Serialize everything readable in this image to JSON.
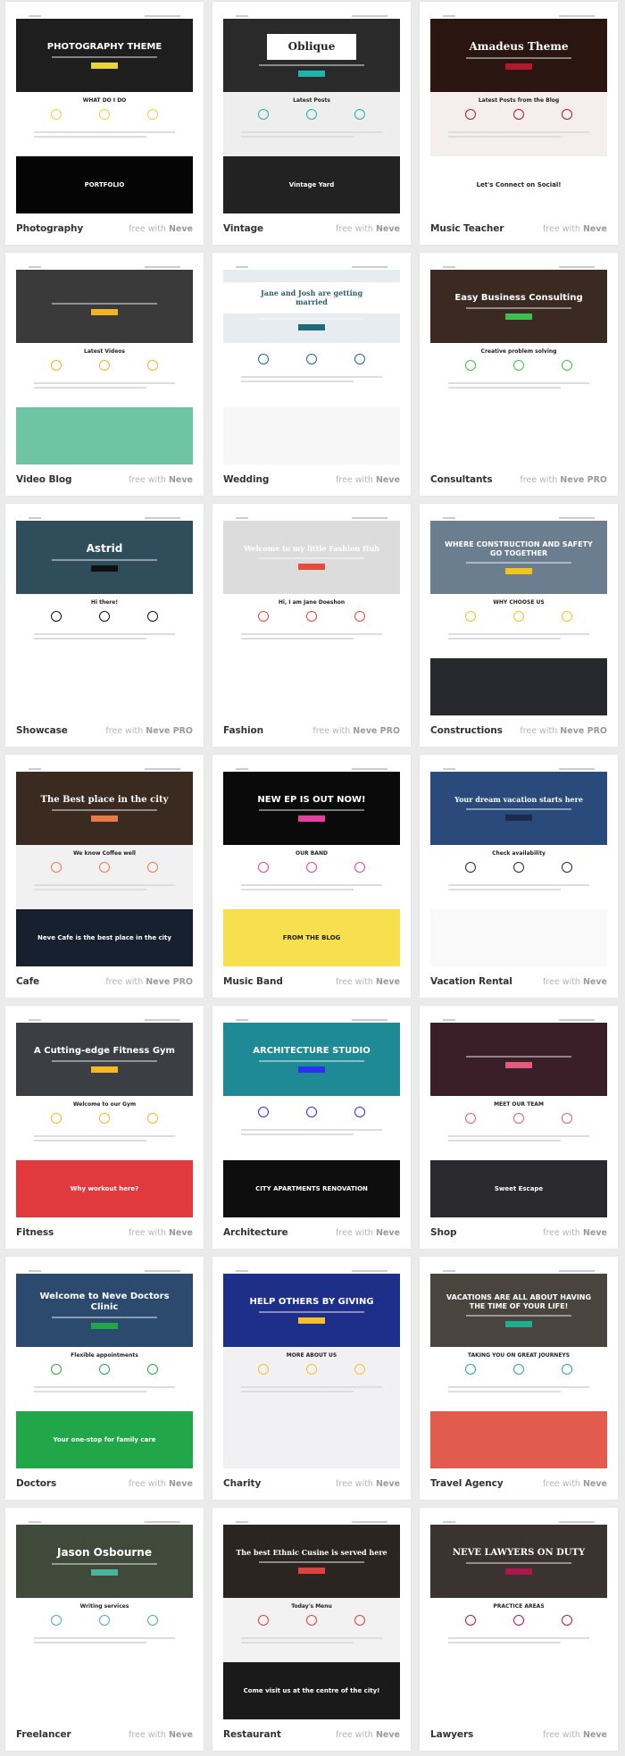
{
  "badge_prefix": "free with",
  "templates": [
    {
      "name": "Photography",
      "plan": "Neve",
      "hero_text": "PHOTOGRAPHY THEME",
      "hero_bg": "#1e1e1e",
      "hero_fg": "#ffffff",
      "hero_serif": false,
      "section_title": "WHAT DO I DO",
      "section_bg": "#ffffff",
      "band_text": "PORTFOLIO",
      "band_bg": "#050505",
      "accent": "#e8d43a"
    },
    {
      "name": "Vintage",
      "plan": "Neve",
      "hero_text": "Oblique",
      "hero_bg": "#2a2a2a",
      "hero_fg": "#222222",
      "hero_serif": true,
      "section_title": "Latest Posts",
      "section_bg": "#eeeeee",
      "band_text": "Vintage Yard",
      "band_bg": "#222222",
      "accent": "#1fb5ac"
    },
    {
      "name": "Music Teacher",
      "plan": "Neve",
      "hero_text": "Amadeus Theme",
      "hero_bg": "#2a1510",
      "hero_fg": "#ffffff",
      "hero_serif": true,
      "section_title": "Latest Posts from the Blog",
      "section_bg": "#f4efec",
      "band_text": "Let's Connect on Social!",
      "band_bg": "#ffffff",
      "accent": "#b01a2c"
    },
    {
      "name": "Video Blog",
      "plan": "Neve",
      "hero_text": "",
      "hero_bg": "#3a3a3a",
      "hero_fg": "#ffffff",
      "hero_serif": false,
      "section_title": "Latest Videos",
      "section_bg": "#ffffff",
      "band_text": "",
      "band_bg": "#6fc5a3",
      "accent": "#f0b429"
    },
    {
      "name": "Wedding",
      "plan": "Neve",
      "hero_text": "Jane and Josh are getting married",
      "hero_bg": "#e6ecef",
      "hero_fg": "#2a5d6e",
      "hero_serif": true,
      "section_title": "",
      "section_bg": "#ffffff",
      "band_text": "",
      "band_bg": "#f7f7f7",
      "accent": "#1f6a78"
    },
    {
      "name": "Consultants",
      "plan": "Neve PRO",
      "hero_text": "Easy Business Consulting",
      "hero_bg": "#3b2a22",
      "hero_fg": "#ffffff",
      "hero_serif": false,
      "section_title": "Creative problem solving",
      "section_bg": "#ffffff",
      "band_text": "",
      "band_bg": "#ffffff",
      "accent": "#3cc04b"
    },
    {
      "name": "Showcase",
      "plan": "Neve PRO",
      "hero_text": "Astrid",
      "hero_bg": "#2f4d5a",
      "hero_fg": "#ffffff",
      "hero_serif": false,
      "section_title": "Hi there!",
      "section_bg": "#ffffff",
      "band_text": "",
      "band_bg": "#ffffff",
      "accent": "#111111"
    },
    {
      "name": "Fashion",
      "plan": "Neve PRO",
      "hero_text": "Welcome to my little Fashion Hub",
      "hero_bg": "#dcdcdc",
      "hero_fg": "#ffffff",
      "hero_serif": true,
      "section_title": "Hi, I am Jane Doeshon",
      "section_bg": "#ffffff",
      "band_text": "",
      "band_bg": "#ffffff",
      "accent": "#e24c3d"
    },
    {
      "name": "Constructions",
      "plan": "Neve PRO",
      "hero_text": "WHERE CONSTRUCTION AND SAFETY GO TOGETHER",
      "hero_bg": "#6a7e90",
      "hero_fg": "#ffffff",
      "hero_serif": false,
      "section_title": "WHY CHOOSE US",
      "section_bg": "#ffffff",
      "band_text": "",
      "band_bg": "#27292e",
      "accent": "#f2c318"
    },
    {
      "name": "Cafe",
      "plan": "Neve PRO",
      "hero_text": "The Best place in the city",
      "hero_bg": "#3a2a20",
      "hero_fg": "#ffffff",
      "hero_serif": true,
      "section_title": "We know Coffee well",
      "section_bg": "#f1f1f1",
      "band_text": "Neve Cafe is the best place in the city",
      "band_bg": "#17202e",
      "accent": "#ea7a4a"
    },
    {
      "name": "Music Band",
      "plan": "Neve",
      "hero_text": "NEW EP IS OUT NOW!",
      "hero_bg": "#0a0a0a",
      "hero_fg": "#ffffff",
      "hero_serif": false,
      "section_title": "OUR BAND",
      "section_bg": "#ffffff",
      "band_text": "FROM THE BLOG",
      "band_bg": "#f8df4e",
      "accent": "#e63fa0"
    },
    {
      "name": "Vacation Rental",
      "plan": "Neve",
      "hero_text": "Your dream vacation starts here",
      "hero_bg": "#2b4a7c",
      "hero_fg": "#ffffff",
      "hero_serif": true,
      "section_title": "Check availability",
      "section_bg": "#ffffff",
      "band_text": "",
      "band_bg": "#f9f9f9",
      "accent": "#1a2b4c"
    },
    {
      "name": "Fitness",
      "plan": "Neve",
      "hero_text": "A Cutting-edge Fitness Gym",
      "hero_bg": "#3b3f44",
      "hero_fg": "#ffffff",
      "hero_serif": false,
      "section_title": "Welcome to our Gym",
      "section_bg": "#ffffff",
      "band_text": "Why workout here?",
      "band_bg": "#e03a3e",
      "accent": "#f4b829"
    },
    {
      "name": "Architecture",
      "plan": "Neve",
      "hero_text": "ARCHITECTURE STUDIO",
      "hero_bg": "#1d8a96",
      "hero_fg": "#ffffff",
      "hero_serif": false,
      "section_title": "",
      "section_bg": "#ffffff",
      "band_text": "CITY APARTMENTS RENOVATION",
      "band_bg": "#0e0e0e",
      "accent": "#2b2ff0"
    },
    {
      "name": "Shop",
      "plan": "Neve",
      "hero_text": "",
      "hero_bg": "#3a1f28",
      "hero_fg": "#ffffff",
      "hero_serif": false,
      "section_title": "MEET OUR TEAM",
      "section_bg": "#ffffff",
      "band_text": "Sweet Escape",
      "band_bg": "#2a2a2e",
      "accent": "#e45b7b"
    },
    {
      "name": "Doctors",
      "plan": "Neve",
      "hero_text": "Welcome to Neve Doctors Clinic",
      "hero_bg": "#2c4a6e",
      "hero_fg": "#ffffff",
      "hero_serif": false,
      "section_title": "Flexible appointments",
      "section_bg": "#ffffff",
      "band_text": "Your one-stop for family care",
      "band_bg": "#22a64a",
      "accent": "#22a64a"
    },
    {
      "name": "Charity",
      "plan": "Neve",
      "hero_text": "HELP OTHERS BY GIVING",
      "hero_bg": "#1e2f8a",
      "hero_fg": "#ffffff",
      "hero_serif": false,
      "section_title": "MORE ABOUT US",
      "section_bg": "#f1f1f3",
      "band_text": "",
      "band_bg": "#f1f1f3",
      "accent": "#f5c02a"
    },
    {
      "name": "Travel Agency",
      "plan": "Neve",
      "hero_text": "VACATIONS ARE ALL ABOUT HAVING THE TIME OF YOUR LIFE!",
      "hero_bg": "#4a443e",
      "hero_fg": "#ffffff",
      "hero_serif": false,
      "section_title": "TAKING YOU ON GREAT JOURNEYS",
      "section_bg": "#ffffff",
      "band_text": "",
      "band_bg": "#e15b4f",
      "accent": "#1fae8d"
    },
    {
      "name": "Freelancer",
      "plan": "Neve",
      "hero_text": "Jason Osbourne",
      "hero_bg": "#3f4a3a",
      "hero_fg": "#ffffff",
      "hero_serif": false,
      "section_title": "Writing services",
      "section_bg": "#ffffff",
      "band_text": "",
      "band_bg": "#ffffff",
      "accent": "#4bb39c"
    },
    {
      "name": "Restaurant",
      "plan": "Neve",
      "hero_text": "The best Ethnic Cusine is served here",
      "hero_bg": "#2a2521",
      "hero_fg": "#ffffff",
      "hero_serif": true,
      "section_title": "Today's Menu",
      "section_bg": "#f2f2f2",
      "band_text": "Come visit us at the centre of the city!",
      "band_bg": "#1a1a1a",
      "accent": "#e0413c"
    },
    {
      "name": "Lawyers",
      "plan": "Neve",
      "hero_text": "NEVE LAWYERS ON DUTY",
      "hero_bg": "#3b3330",
      "hero_fg": "#ffffff",
      "hero_serif": true,
      "section_title": "PRACTICE AREAS",
      "section_bg": "#ffffff",
      "band_text": "",
      "band_bg": "#ffffff",
      "accent": "#b0174f"
    }
  ]
}
